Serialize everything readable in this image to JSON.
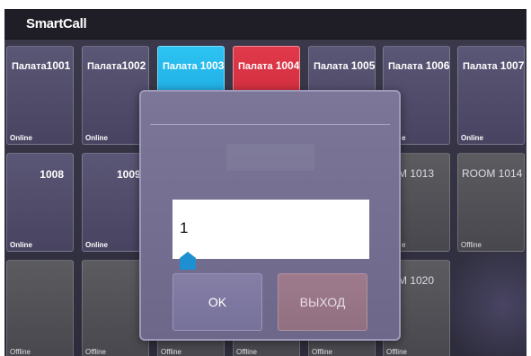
{
  "app": {
    "title": "SmartCall"
  },
  "tiles": [
    {
      "label": "Палата",
      "number": "1001",
      "status": "Online",
      "state": "online"
    },
    {
      "label": "Палата",
      "number": "1002",
      "status": "Online",
      "state": "online"
    },
    {
      "label": "Палата",
      "number": "1003",
      "status": "",
      "state": "active-blue"
    },
    {
      "label": "Палата",
      "number": "1004",
      "status": "",
      "state": "active-red"
    },
    {
      "label": "Палата",
      "number": "1005",
      "status": "",
      "state": "online"
    },
    {
      "label": "Палата",
      "number": "1006",
      "status": "e",
      "state": "online"
    },
    {
      "label": "Палата",
      "number": "1007",
      "status": "Online",
      "state": "online"
    },
    {
      "label": "",
      "number": "1008",
      "status": "Online",
      "state": "online"
    },
    {
      "label": "",
      "number": "1009",
      "status": "Online",
      "state": "online"
    },
    {
      "label": "",
      "number": "M 1013",
      "status": "e",
      "state": "offline"
    },
    {
      "label": "",
      "number": "ROOM 1014",
      "status": "Offline",
      "state": "offline"
    },
    {
      "label": "",
      "number": "",
      "status": "Offline",
      "state": "offline"
    },
    {
      "label": "",
      "number": "",
      "status": "Offline",
      "state": "offline"
    },
    {
      "label": "",
      "number": "",
      "status": "Offline",
      "state": "offline"
    },
    {
      "label": "",
      "number": "",
      "status": "Offline",
      "state": "offline"
    },
    {
      "label": "",
      "number": "",
      "status": "Offline",
      "state": "offline"
    },
    {
      "label": "",
      "number": "M 1020",
      "status": "Offline",
      "state": "offline"
    }
  ],
  "dialog": {
    "input_value": "1",
    "ok_label": "OK",
    "exit_label": "ВЫХОД"
  },
  "colors": {
    "accent_blue": "#1fb0e8",
    "alert_red": "#d42f40",
    "topbar": "#1f1e27"
  }
}
